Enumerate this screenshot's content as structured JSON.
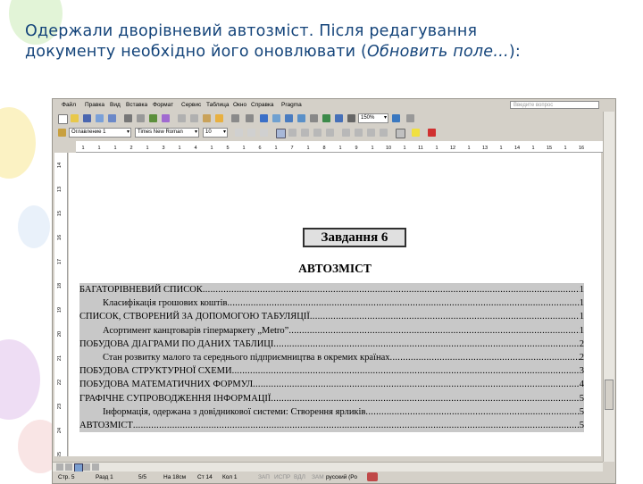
{
  "caption": {
    "line1": "Одержали дворівневий автозміст. Після редагування",
    "line2_a": "документу необхідно його оновлювати (",
    "line2_italic": "Обновить поле…",
    "line2_b": "):"
  },
  "menu": {
    "items": [
      "Файл",
      "Правка",
      "Вид",
      "Вставка",
      "Формат",
      "Сервис",
      "Таблица",
      "Окно",
      "Справка",
      "Pragma"
    ],
    "ask_placeholder": "Введите вопрос"
  },
  "formatting": {
    "style": "Оглавление 1",
    "font": "Times New Roman",
    "size": "10",
    "zoom": "150%"
  },
  "ruler": {
    "top_marks": [
      "1",
      "1",
      "1",
      "2",
      "1",
      "3",
      "1",
      "4",
      "1",
      "5",
      "1",
      "6",
      "1",
      "7",
      "1",
      "8",
      "1",
      "9",
      "1",
      "10",
      "1",
      "11",
      "1",
      "12",
      "1",
      "13",
      "1",
      "14",
      "1",
      "15",
      "1",
      "16"
    ],
    "left_marks": [
      "14",
      "13",
      "15",
      "16",
      "17",
      "18",
      "19",
      "20",
      "21",
      "22",
      "23",
      "24",
      "25"
    ]
  },
  "document": {
    "task_heading": "Завдання 6",
    "toc_heading": "АВТОЗМІСТ",
    "toc": [
      {
        "title": "БАГАТОРІВНЕВИЙ СПИСОК",
        "page": "1",
        "level": 1
      },
      {
        "title": "Класифікація грошових коштів",
        "page": "1",
        "level": 2
      },
      {
        "title": "СПИСОК, СТВОРЕНИЙ ЗА ДОПОМОГОЮ ТАБУЛЯЦІЇ",
        "page": "1",
        "level": 1
      },
      {
        "title": "Асортимент  канцтоварів гіпермаркету „Metro”",
        "page": "1",
        "level": 2
      },
      {
        "title": "ПОБУДОВА ДІАГРАМИ ПО ДАНИХ ТАБЛИЦІ",
        "page": "2",
        "level": 1
      },
      {
        "title": "Стан розвитку малого та середнього підприємництва в окремих країнах",
        "page": "2",
        "level": 2
      },
      {
        "title": "ПОБУДОВА СТРУКТУРНОЇ СХЕМИ",
        "page": "3",
        "level": 1
      },
      {
        "title": "ПОБУДОВА МАТЕМАТИЧНИХ ФОРМУЛ",
        "page": "4",
        "level": 1
      },
      {
        "title": "ГРАФІЧНЕ СУПРОВОДЖЕННЯ ІНФОРМАЦІЇ",
        "page": "5",
        "level": 1
      },
      {
        "title": "Інформація, одержана з довідникової системи: Створення ярликів",
        "page": "5",
        "level": 2
      },
      {
        "title": "АВТОЗМІСТ",
        "page": "5",
        "level": 1
      }
    ]
  },
  "status": {
    "page": "Стр. 5",
    "section": "Разд 1",
    "pages": "5/5",
    "at": "На 18см",
    "line": "Ст 14",
    "col": "Кол 1",
    "rec": "ЗАП",
    "trk": "ИСПР",
    "ext": "ВДЛ",
    "ovr": "ЗАМ",
    "lang": "русский (Ро"
  },
  "colors": {
    "caption": "#14447a",
    "toc_highlight": "#c8c8c8",
    "window": "#d4d0c8"
  }
}
